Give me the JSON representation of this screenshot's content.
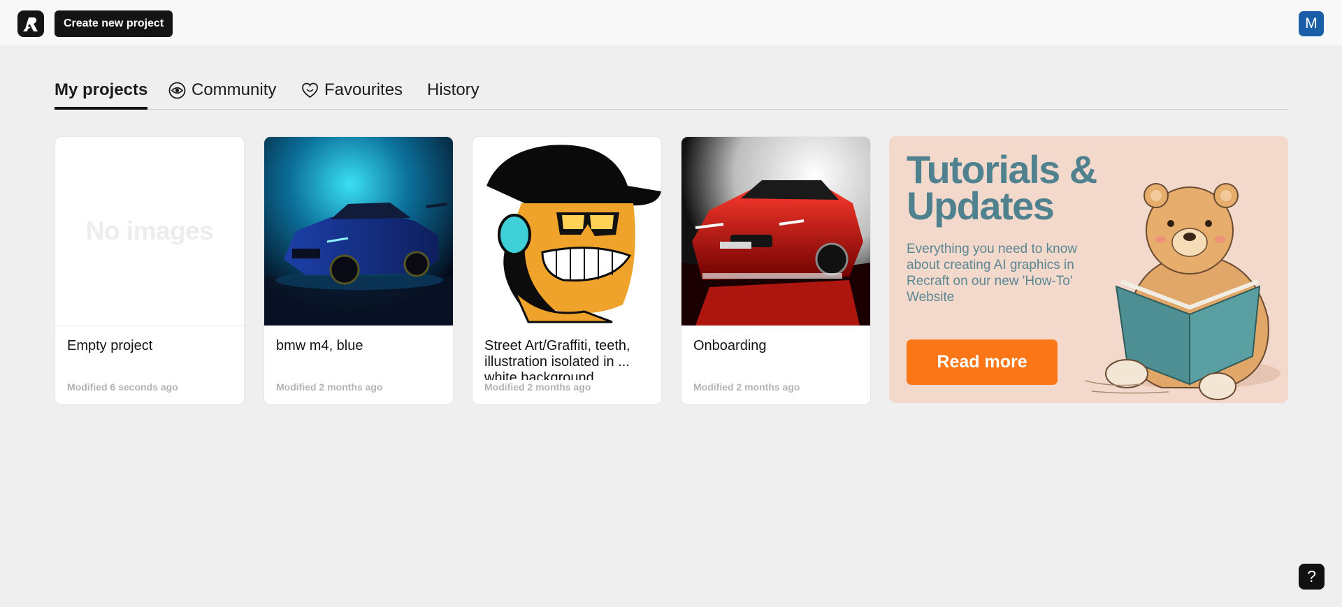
{
  "header": {
    "logo_icon": "recraft-logo-icon",
    "create_button_label": "Create new project",
    "avatar_initial": "M"
  },
  "tabs": [
    {
      "label": "My projects",
      "active": true
    },
    {
      "label": "Community",
      "icon": "eye-icon"
    },
    {
      "label": "Favourites",
      "icon": "heart-icon"
    },
    {
      "label": "History"
    }
  ],
  "projects": [
    {
      "title": "Empty project",
      "modified": "Modified 6 seconds ago",
      "placeholder": "No images"
    },
    {
      "title": "bmw m4, blue",
      "modified": "Modified 2 months ago"
    },
    {
      "title": "Street Art/Graffiti, teeth, illustration isolated in ... white background",
      "modified": "Modified 2 months ago"
    },
    {
      "title": "Onboarding",
      "modified": "Modified 2 months ago"
    }
  ],
  "tutorial": {
    "title": "Tutorials & Updates",
    "text": "Everything you need to know about creating AI graphics in Recraft on our new 'How-To' Website",
    "button_label": "Read more"
  },
  "help_label": "?",
  "colors": {
    "accent_orange": "#fa7616",
    "tutorial_bg": "#f3d9cc",
    "tutorial_text": "#4f818f",
    "avatar_bg": "#1a5ea8",
    "page_bg": "#efefef"
  }
}
